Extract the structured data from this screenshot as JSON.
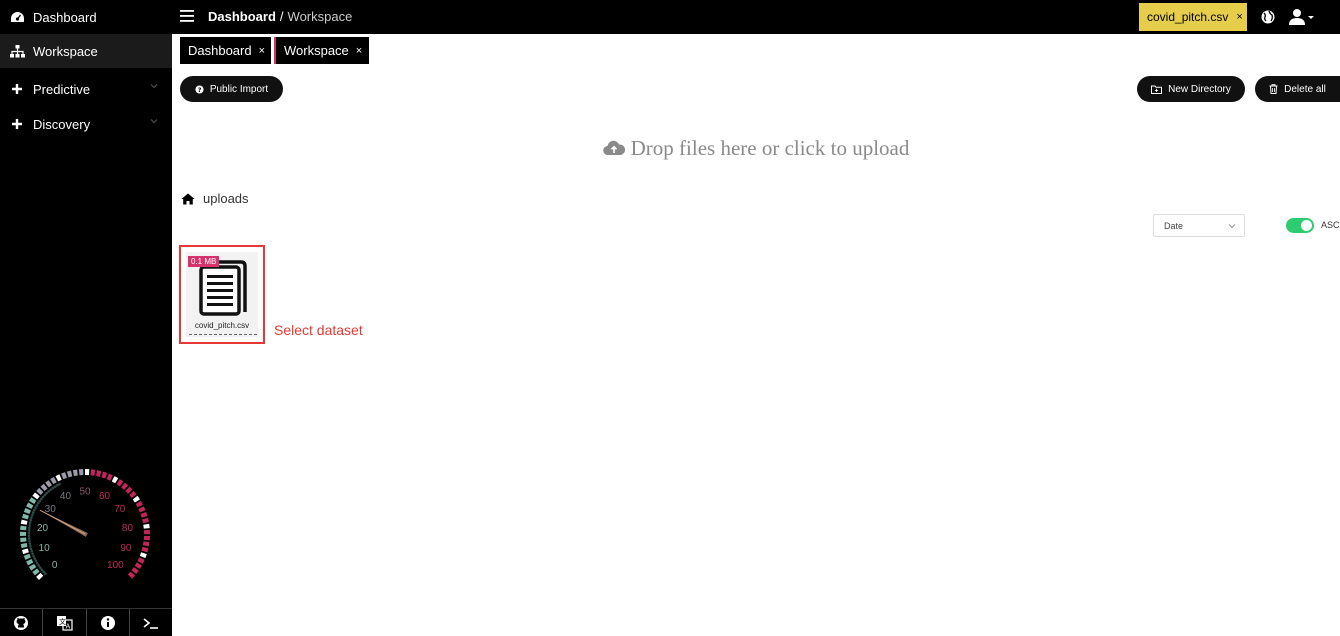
{
  "sidebar": {
    "items": [
      {
        "label": "Dashboard",
        "icon": "dashboard-icon"
      },
      {
        "label": "Workspace",
        "icon": "sitemap-icon"
      },
      {
        "label": "Predictive",
        "icon": "plus-icon"
      },
      {
        "label": "Discovery",
        "icon": "plus-icon"
      }
    ],
    "gauge": {
      "value": 27,
      "ticks": [
        "0",
        "10",
        "20",
        "30",
        "40",
        "50",
        "60",
        "70",
        "80",
        "90",
        "100"
      ]
    },
    "bottom_icons": [
      "github-icon",
      "translate-icon",
      "info-icon",
      "terminal-icon"
    ]
  },
  "topbar": {
    "crumb_main": "Dashboard",
    "crumb_sep": "/",
    "crumb_current": "Workspace",
    "file_chip": "covid_pitch.csv",
    "close": "×"
  },
  "tabs": [
    {
      "label": "Dashboard",
      "close": "×"
    },
    {
      "label": "Workspace",
      "close": "×"
    }
  ],
  "actions": {
    "public_import": "Public Import",
    "new_directory": "New Directory",
    "delete_all": "Delete all"
  },
  "dropzone": {
    "text": "Drop files here or click to upload"
  },
  "path": {
    "folder": "uploads"
  },
  "sort": {
    "selected": "Date",
    "order_label": "ASC",
    "ascending": true
  },
  "files": [
    {
      "name": "covid_pitch.csv",
      "size": "0.1 MB"
    }
  ],
  "annotation": "Select dataset",
  "colors": {
    "accent": "#d6336c",
    "chip": "#e6cd4a",
    "toggle_on": "#2ecc71",
    "highlight": "#e53935"
  }
}
